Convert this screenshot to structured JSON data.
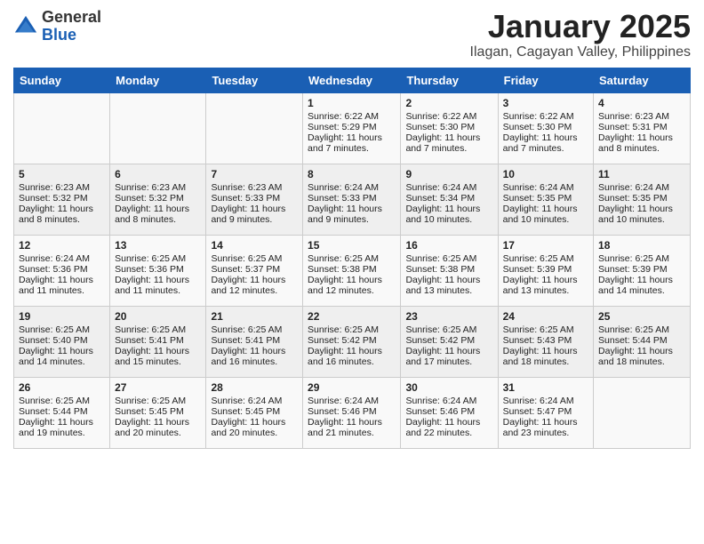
{
  "header": {
    "logo_general": "General",
    "logo_blue": "Blue",
    "title": "January 2025",
    "subtitle": "Ilagan, Cagayan Valley, Philippines"
  },
  "days_of_week": [
    "Sunday",
    "Monday",
    "Tuesday",
    "Wednesday",
    "Thursday",
    "Friday",
    "Saturday"
  ],
  "weeks": [
    [
      {
        "day": "",
        "sunrise": "",
        "sunset": "",
        "daylight": ""
      },
      {
        "day": "",
        "sunrise": "",
        "sunset": "",
        "daylight": ""
      },
      {
        "day": "",
        "sunrise": "",
        "sunset": "",
        "daylight": ""
      },
      {
        "day": "1",
        "sunrise": "Sunrise: 6:22 AM",
        "sunset": "Sunset: 5:29 PM",
        "daylight": "Daylight: 11 hours and 7 minutes."
      },
      {
        "day": "2",
        "sunrise": "Sunrise: 6:22 AM",
        "sunset": "Sunset: 5:30 PM",
        "daylight": "Daylight: 11 hours and 7 minutes."
      },
      {
        "day": "3",
        "sunrise": "Sunrise: 6:22 AM",
        "sunset": "Sunset: 5:30 PM",
        "daylight": "Daylight: 11 hours and 7 minutes."
      },
      {
        "day": "4",
        "sunrise": "Sunrise: 6:23 AM",
        "sunset": "Sunset: 5:31 PM",
        "daylight": "Daylight: 11 hours and 8 minutes."
      }
    ],
    [
      {
        "day": "5",
        "sunrise": "Sunrise: 6:23 AM",
        "sunset": "Sunset: 5:32 PM",
        "daylight": "Daylight: 11 hours and 8 minutes."
      },
      {
        "day": "6",
        "sunrise": "Sunrise: 6:23 AM",
        "sunset": "Sunset: 5:32 PM",
        "daylight": "Daylight: 11 hours and 8 minutes."
      },
      {
        "day": "7",
        "sunrise": "Sunrise: 6:23 AM",
        "sunset": "Sunset: 5:33 PM",
        "daylight": "Daylight: 11 hours and 9 minutes."
      },
      {
        "day": "8",
        "sunrise": "Sunrise: 6:24 AM",
        "sunset": "Sunset: 5:33 PM",
        "daylight": "Daylight: 11 hours and 9 minutes."
      },
      {
        "day": "9",
        "sunrise": "Sunrise: 6:24 AM",
        "sunset": "Sunset: 5:34 PM",
        "daylight": "Daylight: 11 hours and 10 minutes."
      },
      {
        "day": "10",
        "sunrise": "Sunrise: 6:24 AM",
        "sunset": "Sunset: 5:35 PM",
        "daylight": "Daylight: 11 hours and 10 minutes."
      },
      {
        "day": "11",
        "sunrise": "Sunrise: 6:24 AM",
        "sunset": "Sunset: 5:35 PM",
        "daylight": "Daylight: 11 hours and 10 minutes."
      }
    ],
    [
      {
        "day": "12",
        "sunrise": "Sunrise: 6:24 AM",
        "sunset": "Sunset: 5:36 PM",
        "daylight": "Daylight: 11 hours and 11 minutes."
      },
      {
        "day": "13",
        "sunrise": "Sunrise: 6:25 AM",
        "sunset": "Sunset: 5:36 PM",
        "daylight": "Daylight: 11 hours and 11 minutes."
      },
      {
        "day": "14",
        "sunrise": "Sunrise: 6:25 AM",
        "sunset": "Sunset: 5:37 PM",
        "daylight": "Daylight: 11 hours and 12 minutes."
      },
      {
        "day": "15",
        "sunrise": "Sunrise: 6:25 AM",
        "sunset": "Sunset: 5:38 PM",
        "daylight": "Daylight: 11 hours and 12 minutes."
      },
      {
        "day": "16",
        "sunrise": "Sunrise: 6:25 AM",
        "sunset": "Sunset: 5:38 PM",
        "daylight": "Daylight: 11 hours and 13 minutes."
      },
      {
        "day": "17",
        "sunrise": "Sunrise: 6:25 AM",
        "sunset": "Sunset: 5:39 PM",
        "daylight": "Daylight: 11 hours and 13 minutes."
      },
      {
        "day": "18",
        "sunrise": "Sunrise: 6:25 AM",
        "sunset": "Sunset: 5:39 PM",
        "daylight": "Daylight: 11 hours and 14 minutes."
      }
    ],
    [
      {
        "day": "19",
        "sunrise": "Sunrise: 6:25 AM",
        "sunset": "Sunset: 5:40 PM",
        "daylight": "Daylight: 11 hours and 14 minutes."
      },
      {
        "day": "20",
        "sunrise": "Sunrise: 6:25 AM",
        "sunset": "Sunset: 5:41 PM",
        "daylight": "Daylight: 11 hours and 15 minutes."
      },
      {
        "day": "21",
        "sunrise": "Sunrise: 6:25 AM",
        "sunset": "Sunset: 5:41 PM",
        "daylight": "Daylight: 11 hours and 16 minutes."
      },
      {
        "day": "22",
        "sunrise": "Sunrise: 6:25 AM",
        "sunset": "Sunset: 5:42 PM",
        "daylight": "Daylight: 11 hours and 16 minutes."
      },
      {
        "day": "23",
        "sunrise": "Sunrise: 6:25 AM",
        "sunset": "Sunset: 5:42 PM",
        "daylight": "Daylight: 11 hours and 17 minutes."
      },
      {
        "day": "24",
        "sunrise": "Sunrise: 6:25 AM",
        "sunset": "Sunset: 5:43 PM",
        "daylight": "Daylight: 11 hours and 18 minutes."
      },
      {
        "day": "25",
        "sunrise": "Sunrise: 6:25 AM",
        "sunset": "Sunset: 5:44 PM",
        "daylight": "Daylight: 11 hours and 18 minutes."
      }
    ],
    [
      {
        "day": "26",
        "sunrise": "Sunrise: 6:25 AM",
        "sunset": "Sunset: 5:44 PM",
        "daylight": "Daylight: 11 hours and 19 minutes."
      },
      {
        "day": "27",
        "sunrise": "Sunrise: 6:25 AM",
        "sunset": "Sunset: 5:45 PM",
        "daylight": "Daylight: 11 hours and 20 minutes."
      },
      {
        "day": "28",
        "sunrise": "Sunrise: 6:24 AM",
        "sunset": "Sunset: 5:45 PM",
        "daylight": "Daylight: 11 hours and 20 minutes."
      },
      {
        "day": "29",
        "sunrise": "Sunrise: 6:24 AM",
        "sunset": "Sunset: 5:46 PM",
        "daylight": "Daylight: 11 hours and 21 minutes."
      },
      {
        "day": "30",
        "sunrise": "Sunrise: 6:24 AM",
        "sunset": "Sunset: 5:46 PM",
        "daylight": "Daylight: 11 hours and 22 minutes."
      },
      {
        "day": "31",
        "sunrise": "Sunrise: 6:24 AM",
        "sunset": "Sunset: 5:47 PM",
        "daylight": "Daylight: 11 hours and 23 minutes."
      },
      {
        "day": "",
        "sunrise": "",
        "sunset": "",
        "daylight": ""
      }
    ]
  ]
}
